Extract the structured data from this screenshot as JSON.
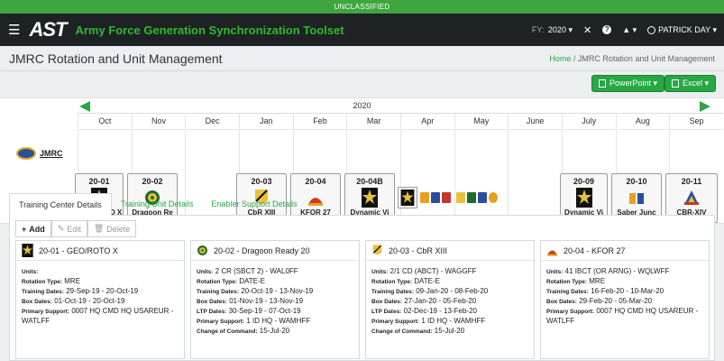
{
  "classification": "UNCLASSIFIED",
  "nav": {
    "logo": "AST",
    "title": "Army Force Generation Synchronization Toolset",
    "fy_label": "FY:",
    "fy_value": "2020 ▾",
    "user": "PATRICK DAY ▾"
  },
  "page": {
    "title": "JMRC Rotation and Unit Management",
    "breadcrumb_home": "Home",
    "breadcrumb_sep": " / ",
    "breadcrumb_current": "JMRC Rotation and Unit Management"
  },
  "toolbar": {
    "powerpoint_label": "PowerPoint ▾",
    "excel_label": "Excel ▾"
  },
  "timeline": {
    "year": "2020",
    "months": [
      "Oct",
      "Nov",
      "Dec",
      "Jan",
      "Feb",
      "Mar",
      "Apr",
      "May",
      "June",
      "July",
      "Aug",
      "Sep"
    ],
    "row_label": "JMRC",
    "rotations": [
      {
        "code": "20-01",
        "name": "GEO/ROTO X",
        "icon": "army-star"
      },
      {
        "code": "20-02",
        "name": "Dragoon Re",
        "icon": "cav-badge"
      },
      {
        "code": "20-03",
        "name": "CbR XIII",
        "icon": "1cd-badge"
      },
      {
        "code": "20-04",
        "name": "KFOR 27",
        "icon": "kfor-badge"
      },
      {
        "code": "20-04B",
        "name": "Dynamic Vi",
        "icon": "army-star"
      },
      {
        "code": "20-09",
        "name": "Dynamic Vi",
        "icon": "army-star"
      },
      {
        "code": "20-10",
        "name": "Saber Junc",
        "icon": "multi-badge"
      },
      {
        "code": "20-11",
        "name": "CBR-XIV",
        "icon": "armor-badge"
      }
    ]
  },
  "tabs": [
    "Training Center Details",
    "Training Unit Details",
    "Enabler Support Details"
  ],
  "actions": {
    "add": "Add",
    "edit": "Edit",
    "delete": "Delete"
  },
  "labels": {
    "units": "Units:",
    "rotation_type": "Rotation Type:",
    "training_dates": "Training Dates:",
    "box_dates": "Box Dates:",
    "ltp_dates": "LTP Dates:",
    "primary_support": "Primary Support:",
    "change_of_command": "Change of Command:"
  },
  "cards": [
    {
      "title": "20-01 - GEO/ROTO X",
      "units": "",
      "rotation_type": "MRE",
      "training_dates": "29-Sep-19  -  20-Oct-19",
      "box_dates": "01-Oct-19  -  20-Oct-19",
      "primary_support": "0007 HQ CMD HQ USAREUR -",
      "primary_support_2": "WATLFF"
    },
    {
      "title": "20-02 - Dragoon Ready 20",
      "units": "2 CR (SBCT 2) - WAL0FF",
      "rotation_type": "DATE-E",
      "training_dates": "20-Oct-19  -  13-Nov-19",
      "box_dates": "01-Nov-19  -  13-Nov-19",
      "ltp_dates": "30-Sep-19  -  07-Oct-19",
      "primary_support": "1 ID HQ - WAMHFF",
      "change_of_command": "15-Jul-20"
    },
    {
      "title": "20-03 - CbR XIII",
      "units": "2/1 CD (ABCT) - WAGGFF",
      "rotation_type": "DATE-E",
      "training_dates": "09-Jan-20  -  08-Feb-20",
      "box_dates": "27-Jan-20  -  05-Feb-20",
      "ltp_dates": "02-Dec-19  -  13-Feb-20",
      "primary_support": "1 ID HQ - WAMHFF",
      "change_of_command": "15-Jul-20"
    },
    {
      "title": "20-04 - KFOR 27",
      "units": "41 IBCT (OR ARNG) - WQLWFF",
      "rotation_type": "MRE",
      "training_dates": "16-Feb-20  -  10-Mar-20",
      "box_dates": "29-Feb-20  -  05-Mar-20",
      "primary_support": "0007 HQ CMD HQ USAREUR -",
      "primary_support_2": "WATLFF"
    }
  ]
}
